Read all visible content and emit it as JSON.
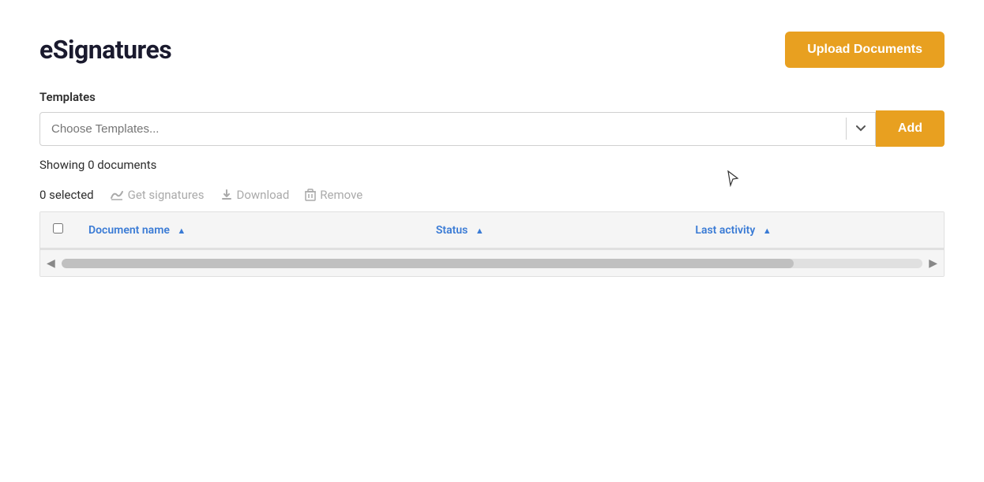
{
  "app": {
    "title": "eSignatures"
  },
  "header": {
    "upload_button_label": "Upload Documents"
  },
  "templates": {
    "label": "Templates",
    "placeholder": "Choose Templates...",
    "add_button_label": "Add"
  },
  "documents": {
    "showing_label": "Showing 0 documents"
  },
  "toolbar": {
    "selected_label": "0 selected",
    "get_signatures_label": "Get signatures",
    "download_label": "Download",
    "remove_label": "Remove"
  },
  "table": {
    "columns": [
      {
        "key": "checkbox",
        "label": ""
      },
      {
        "key": "document_name",
        "label": "Document name",
        "sort": "asc"
      },
      {
        "key": "status",
        "label": "Status",
        "sort": "both"
      },
      {
        "key": "last_activity",
        "label": "Last activity",
        "sort": "both"
      }
    ],
    "rows": []
  },
  "colors": {
    "accent": "#e8a020",
    "link": "#3a7bd5",
    "muted": "#aaaaaa"
  }
}
